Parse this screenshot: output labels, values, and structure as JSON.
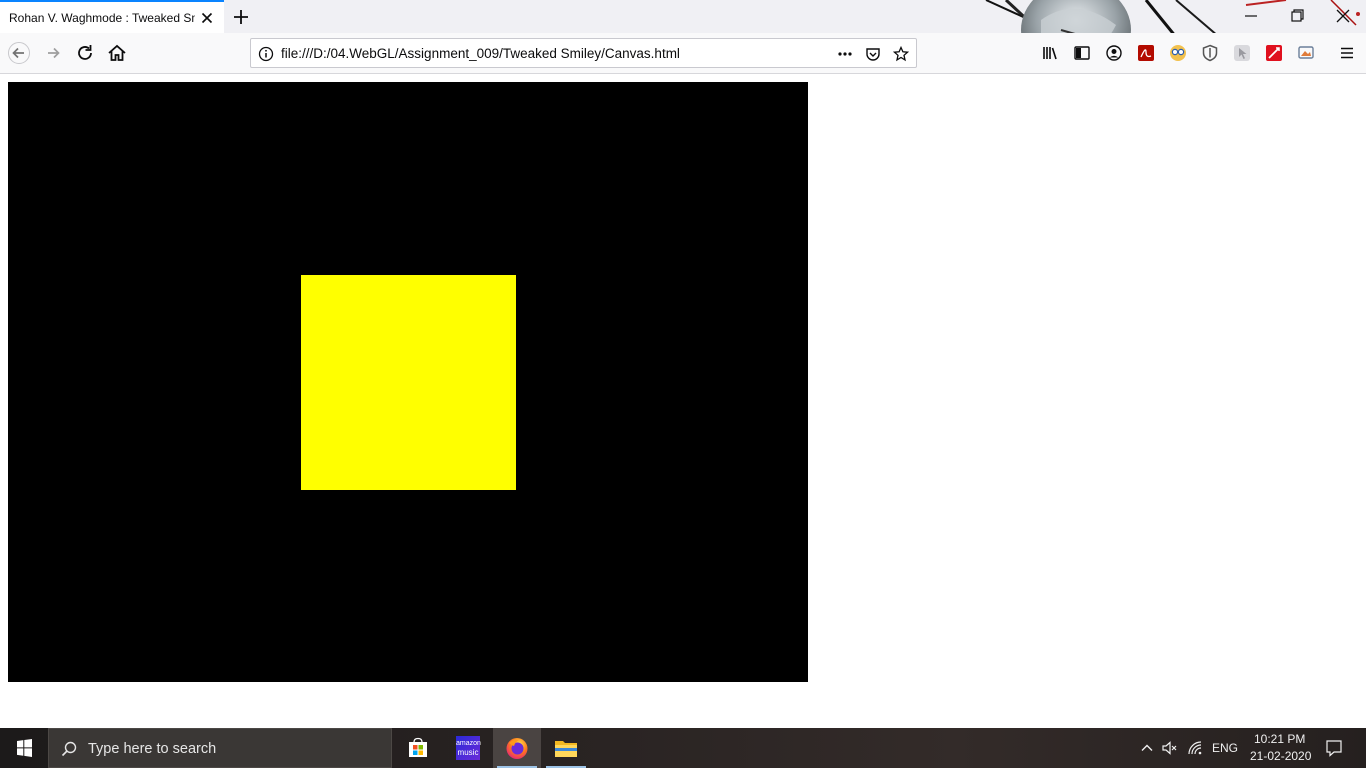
{
  "browser": {
    "tab_title": "Rohan V. Waghmode : Tweaked Smiley",
    "url": "file:///D:/04.WebGL/Assignment_009/Tweaked Smiley/Canvas.html"
  },
  "canvas": {
    "background": "#000000",
    "quad_color": "#ffff00"
  },
  "taskbar": {
    "search_placeholder": "Type here to search",
    "amazon_label_top": "amazon",
    "amazon_label_bottom": "music",
    "language": "ENG",
    "time": "10:21 PM",
    "date": "21-02-2020"
  }
}
